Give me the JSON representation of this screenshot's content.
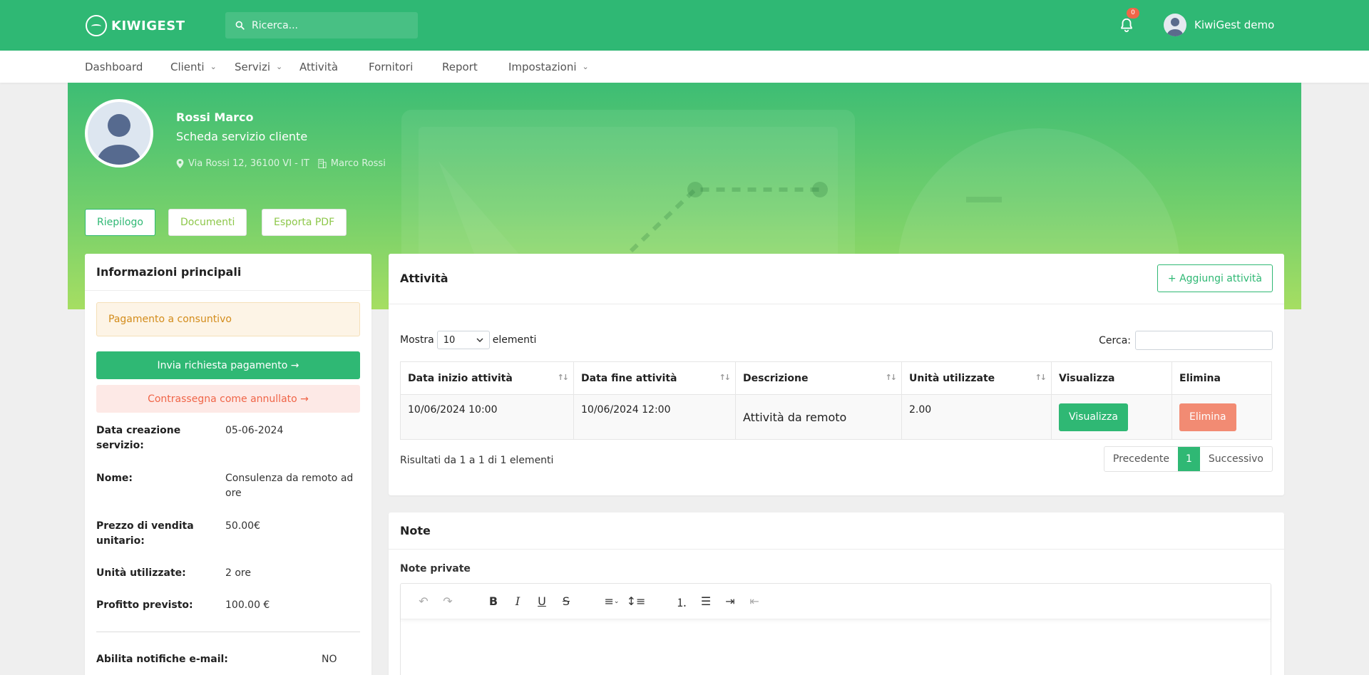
{
  "app": {
    "logo_text": "KIWIGEST"
  },
  "search": {
    "placeholder": "Ricerca..."
  },
  "notifications": {
    "count": "0"
  },
  "user": {
    "name": "KiwiGest demo"
  },
  "menu": [
    {
      "label": "Dashboard",
      "has_dropdown": false
    },
    {
      "label": "Clienti",
      "has_dropdown": true
    },
    {
      "label": "Servizi",
      "has_dropdown": true
    },
    {
      "label": "Attività",
      "has_dropdown": false
    },
    {
      "label": "Fornitori",
      "has_dropdown": false
    },
    {
      "label": "Report",
      "has_dropdown": false
    },
    {
      "label": "Impostazioni",
      "has_dropdown": true
    }
  ],
  "profile": {
    "name": "Rossi Marco",
    "subtitle": "Scheda servizio cliente",
    "address": "Via Rossi 12, 36100 VI - IT",
    "company": "Marco Rossi"
  },
  "hero_tabs": [
    "Riepilogo",
    "Documenti",
    "Esporta PDF"
  ],
  "info": {
    "title": "Informazioni principali",
    "payment_notice": "Pagamento a consuntivo",
    "send_payment_button": "Invia richiesta pagamento →",
    "mark_cancelled_button": "Contrassegna come annullato →",
    "rows": [
      {
        "label": "Data creazione servizio:",
        "value": "05-06-2024"
      },
      {
        "label": "Nome:",
        "value": "Consulenza da remoto ad ore"
      },
      {
        "label": "Prezzo di vendita unitario:",
        "value": "50.00€"
      },
      {
        "label": "Unità utilizzate:",
        "value": "2 ore"
      },
      {
        "label": "Profitto previsto:",
        "value": "100.00 €"
      }
    ],
    "email_notifications_label": "Abilita notifiche e-mail:",
    "email_notifications_value": "NO"
  },
  "activities": {
    "title": "Attività",
    "add_button": "+ Aggiungi attività",
    "show_label": "Mostra",
    "page_length": "10",
    "elements_label": "elementi",
    "search_label": "Cerca:",
    "columns": [
      "Data inizio attività",
      "Data fine attività",
      "Descrizione",
      "Unità utilizzate",
      "Visualizza",
      "Elimina"
    ],
    "rows": [
      {
        "start": "10/06/2024 10:00",
        "end": "10/06/2024 12:00",
        "description": "Attività da remoto",
        "units": "2.00",
        "view_button": "Visualizza",
        "delete_button": "Elimina"
      }
    ],
    "results_text": "Risultati da 1 a 1 di 1 elementi",
    "pagination": {
      "prev": "Precedente",
      "current": "1",
      "next": "Successivo"
    }
  },
  "notes": {
    "title": "Note",
    "private_label": "Note private"
  },
  "colors": {
    "primary": "#2fb874",
    "danger": "#f06548",
    "warning": "#d38c1b"
  }
}
